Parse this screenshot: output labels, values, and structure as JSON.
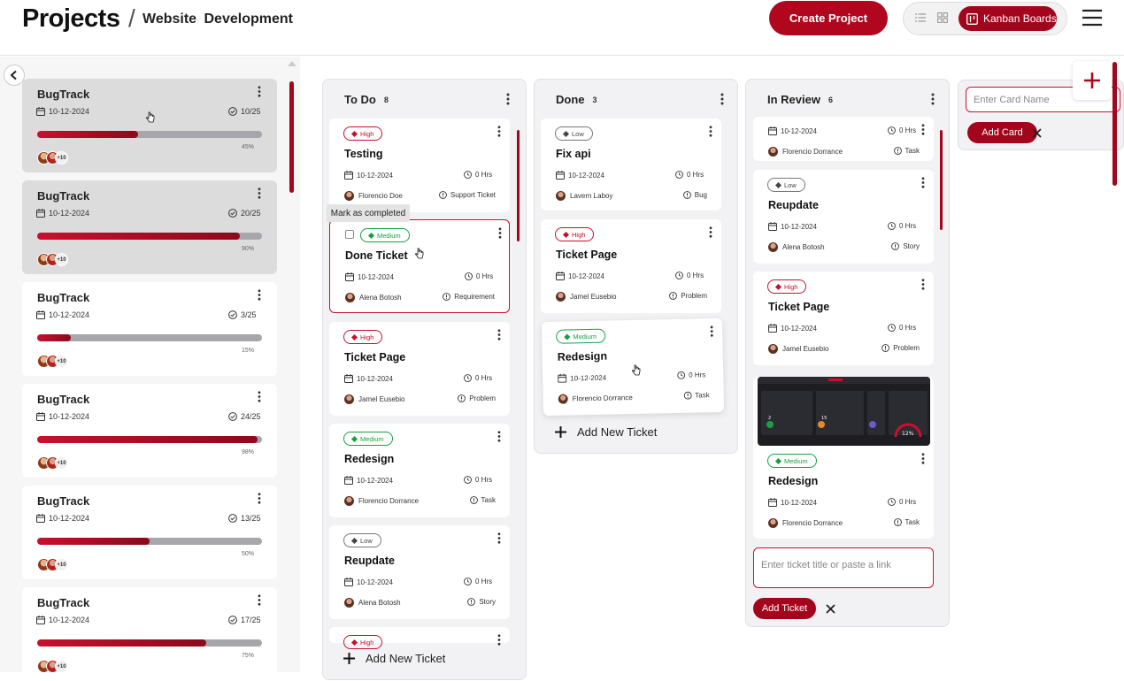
{
  "header": {
    "title": "Projects",
    "separator": "/",
    "breadcrumb": "Website  Development",
    "create_button": "Create Project",
    "view_kanban": "Kanban Boards"
  },
  "colors": {
    "accent": "#a3061c",
    "high": "#c8102e",
    "medium": "#1a9e43",
    "low": "#777777"
  },
  "projects": [
    {
      "name": "BugTrack",
      "date": "10-12-2024",
      "count": "10/25",
      "progress": 0.45,
      "pct": "45%",
      "more": "+10",
      "selected": true
    },
    {
      "name": "BugTrack",
      "date": "10-12-2024",
      "count": "20/25",
      "progress": 0.9,
      "pct": "90%",
      "more": "+10",
      "selected": true
    },
    {
      "name": "BugTrack",
      "date": "10-12-2024",
      "count": "3/25",
      "progress": 0.15,
      "pct": "15%",
      "more": "+10",
      "selected": false
    },
    {
      "name": "BugTrack",
      "date": "10-12-2024",
      "count": "24/25",
      "progress": 0.98,
      "pct": "98%",
      "more": "+10",
      "selected": false
    },
    {
      "name": "BugTrack",
      "date": "10-12-2024",
      "count": "13/25",
      "progress": 0.5,
      "pct": "50%",
      "more": "+10",
      "selected": false
    },
    {
      "name": "BugTrack",
      "date": "10-12-2024",
      "count": "17/25",
      "progress": 0.75,
      "pct": "75%",
      "more": "+10",
      "selected": false
    }
  ],
  "columns": {
    "todo": {
      "title": "To Do",
      "count": "8",
      "tooltip": "Mark as completed",
      "add_new": "Add New Ticket",
      "cards": [
        {
          "priority": "High",
          "title": "Testing",
          "date": "10-12-2024",
          "hours": "0 Hrs",
          "user": "Florencio Doe",
          "type": "Support Ticket"
        },
        {
          "priority": "Medium",
          "title": "Done Ticket",
          "date": "10-12-2024",
          "hours": "0 Hrs",
          "user": "Alena Botosh",
          "type": "Requirement"
        },
        {
          "priority": "High",
          "title": "Ticket Page",
          "date": "10-12-2024",
          "hours": "0 Hrs",
          "user": "Jamel Eusebio",
          "type": "Problem"
        },
        {
          "priority": "Medium",
          "title": "Redesign",
          "date": "10-12-2024",
          "hours": "0 Hrs",
          "user": "Florencio Dorrance",
          "type": "Task"
        },
        {
          "priority": "Low",
          "title": "Reupdate",
          "date": "10-12-2024",
          "hours": "0 Hrs",
          "user": "Alena Botosh",
          "type": "Story"
        },
        {
          "priority": "High"
        }
      ]
    },
    "done": {
      "title": "Done",
      "count": "3",
      "add_new": "Add New Ticket",
      "cards": [
        {
          "priority": "Low",
          "title": "Fix api",
          "date": "10-12-2024",
          "hours": "0 Hrs",
          "user": "Lavern Laboy",
          "type": "Bug"
        },
        {
          "priority": "High",
          "title": "Ticket Page",
          "date": "10-12-2024",
          "hours": "0 Hrs",
          "user": "Jamel Eusebio",
          "type": "Problem"
        },
        {
          "priority": "Medium",
          "title": "Redesign",
          "date": "10-12-2024",
          "hours": "0 Hrs",
          "user": "Florencio Dorrance",
          "type": "Task"
        }
      ]
    },
    "review": {
      "title": "In Review",
      "count": "6",
      "input_placeholder": "Enter ticket title or paste a link",
      "add_button": "Add Ticket",
      "cards": [
        {
          "date": "10-12-2024",
          "hours": "0 Hrs",
          "user": "Florencio Dorrance",
          "type": "Task"
        },
        {
          "priority": "Low",
          "title": "Reupdate",
          "date": "10-12-2024",
          "hours": "0 Hrs",
          "user": "Alena Botosh",
          "type": "Story"
        },
        {
          "priority": "High",
          "title": "Ticket Page",
          "date": "10-12-2024",
          "hours": "0 Hrs",
          "user": "Jamel Eusebio",
          "type": "Problem"
        },
        {
          "priority": "Medium",
          "title": "Redesign",
          "date": "10-12-2024",
          "hours": "0 Hrs",
          "user": "Florencio Dorrance",
          "type": "Task"
        }
      ]
    }
  },
  "new_card": {
    "placeholder": "Enter Card Name",
    "add_button": "Add Card"
  },
  "icons": [
    "back-icon",
    "list-view-icon",
    "grid-view-icon",
    "kanban-icon",
    "hamburger-menu-icon",
    "calendar-icon",
    "check-circle-icon",
    "clock-icon",
    "info-icon",
    "more-vertical-icon",
    "plus-icon",
    "close-icon",
    "cursor-icon"
  ]
}
